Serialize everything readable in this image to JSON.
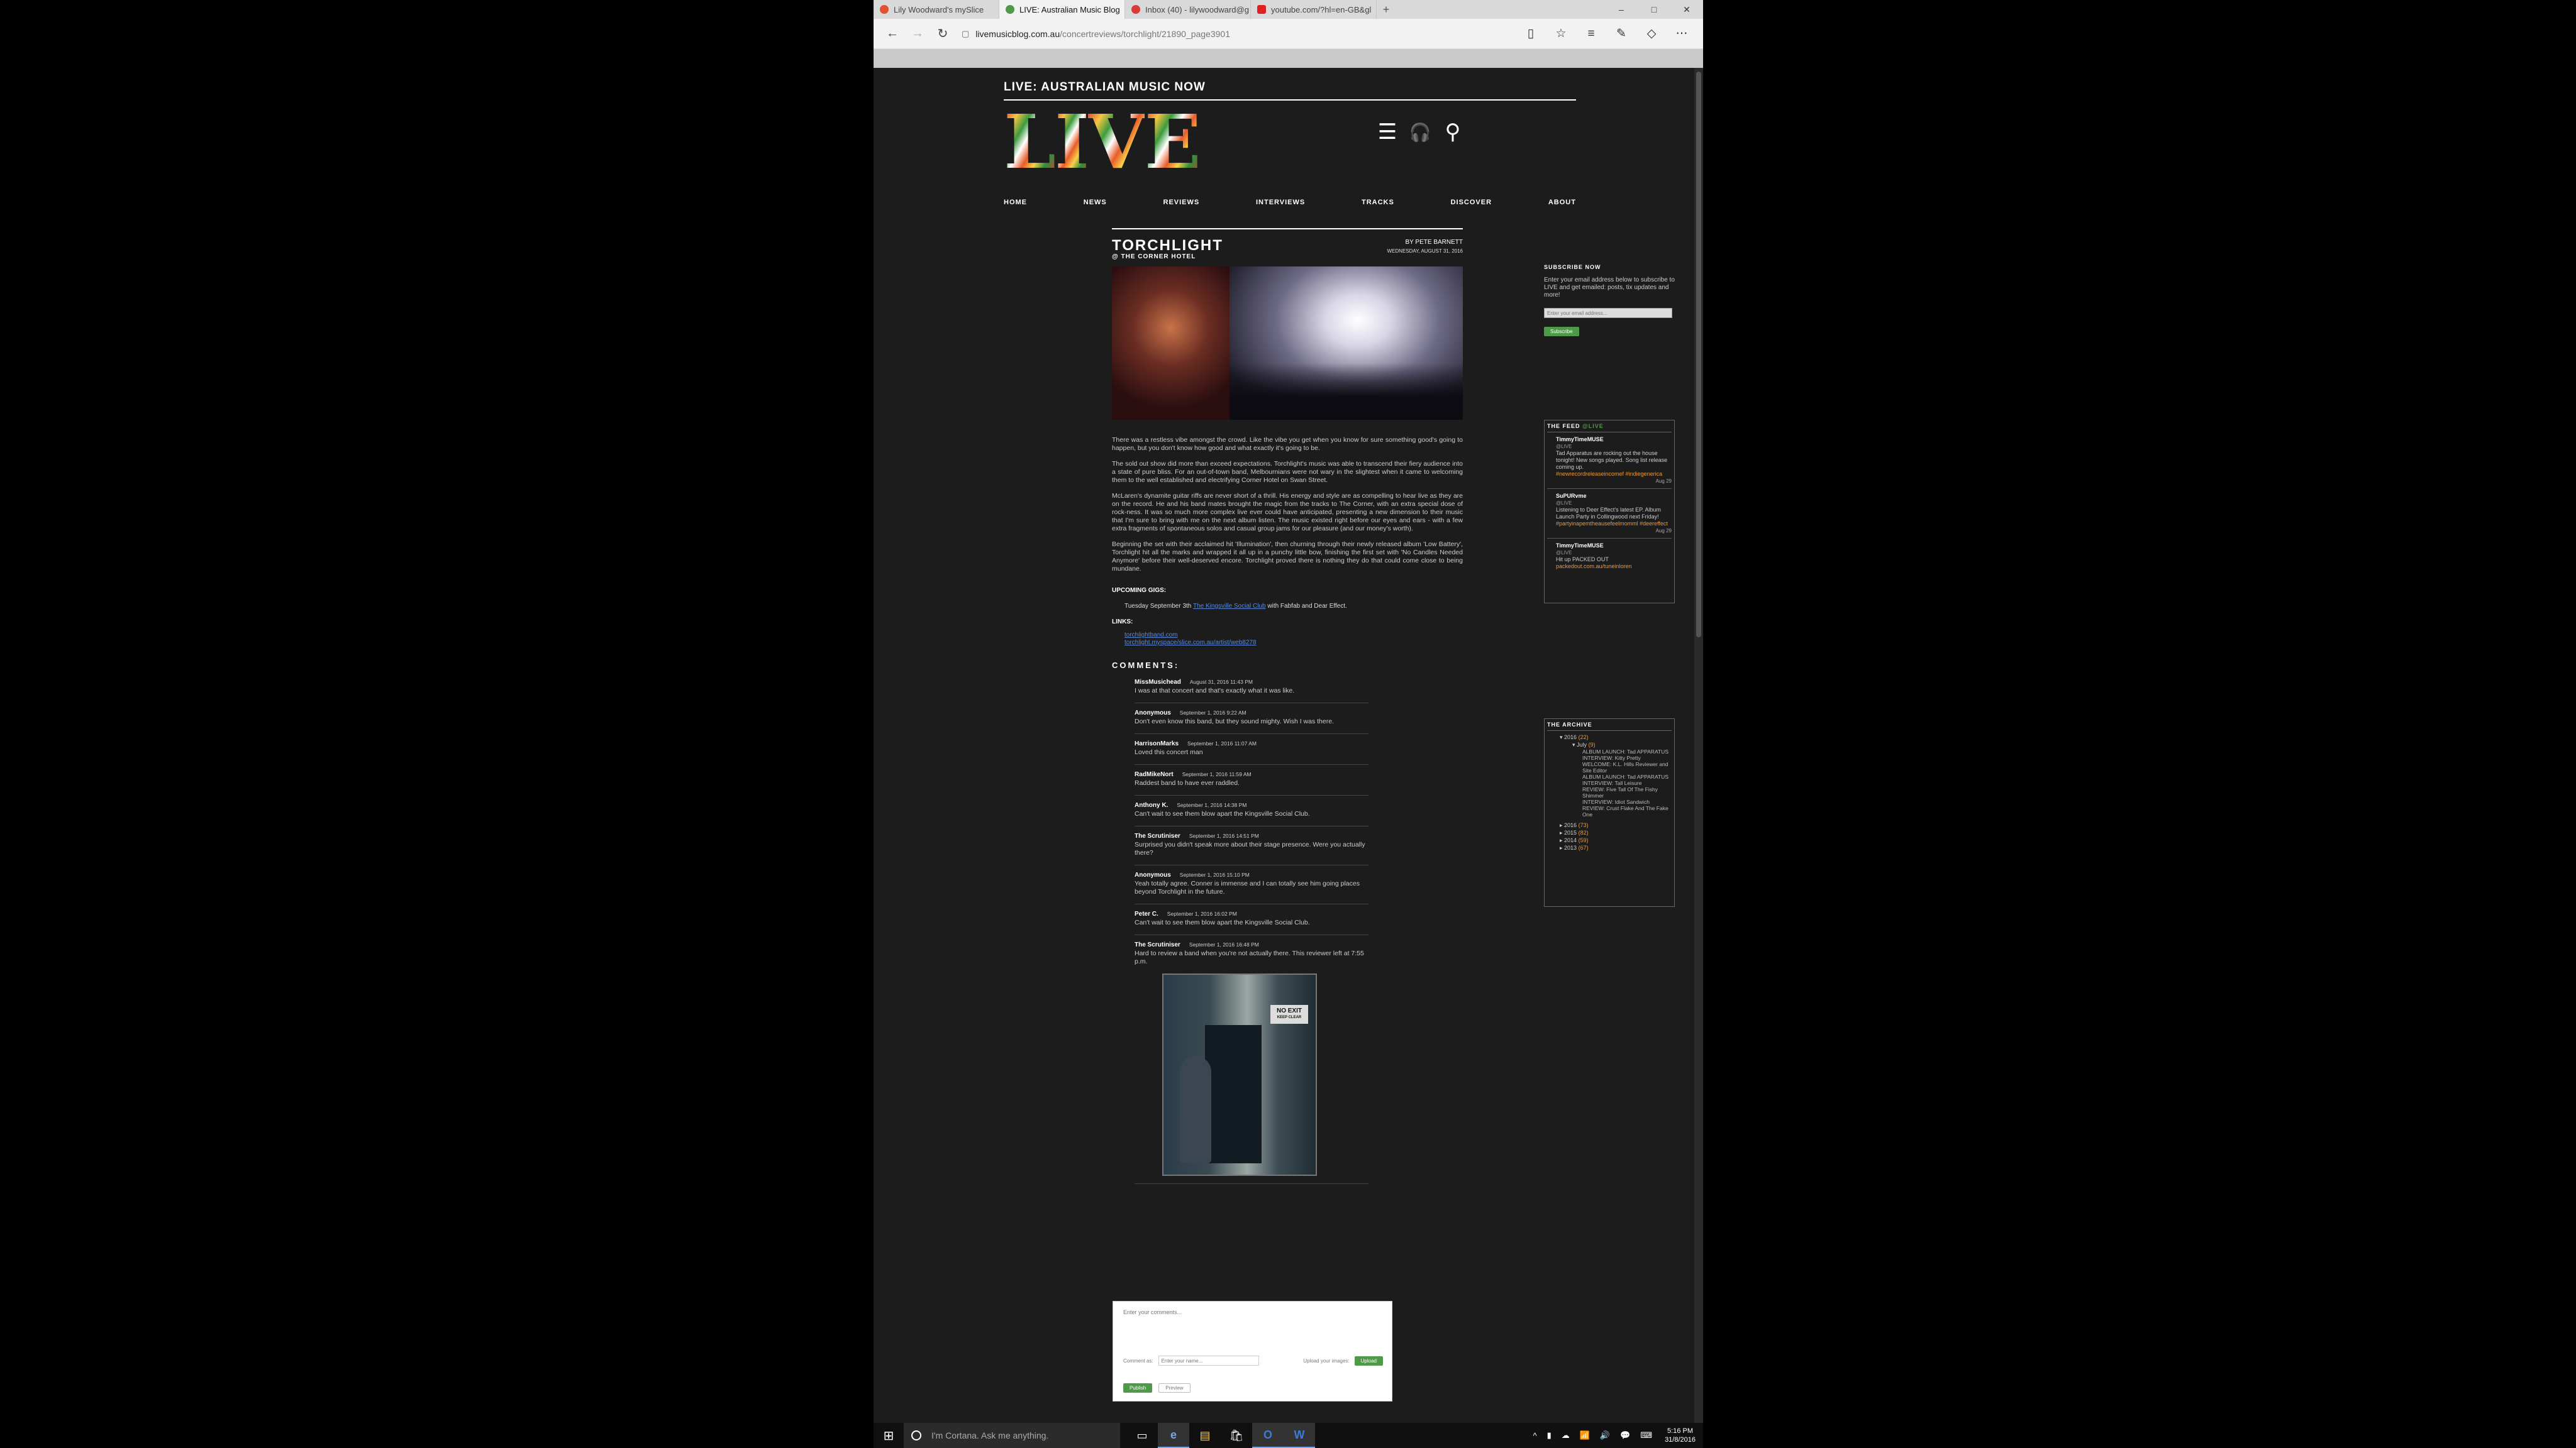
{
  "browser": {
    "tabs": [
      {
        "label": "Lily Woodward's mySlice",
        "color": "#e0522d",
        "active": false
      },
      {
        "label": "LIVE: Australian Music Blog",
        "color": "#4f9a49",
        "active": true
      },
      {
        "label": "Inbox (40) - lilywoodward@g",
        "color": "#d93b3b",
        "active": false
      },
      {
        "label": "youtube.com/?hl=en-GB&gl",
        "color": "#e02020",
        "active": false
      }
    ],
    "url_domain": "livemusicblog.com.au",
    "url_path": "/concertreviews/torchlight/21890_page3901",
    "back_icon": "←",
    "forward_icon": "→",
    "refresh_icon": "↻",
    "new_tab_icon": "+",
    "minimize_icon": "–",
    "maximize_icon": "□",
    "close_icon": "✕",
    "reading_icon": "▯",
    "star_icon": "☆",
    "hub_icon": "≡",
    "note_icon": "✎",
    "share_icon": "◇",
    "more_icon": "⋯"
  },
  "site": {
    "tagline": "LIVE: AUSTRALIAN MUSIC NOW",
    "logo_letters": [
      "L",
      "I",
      "V",
      "E"
    ],
    "menu_icon": "☰",
    "headphones_icon": "🎧",
    "search_icon": "⚲",
    "nav": [
      "HOME",
      "NEWS",
      "REVIEWS",
      "INTERVIEWS",
      "TRACKS",
      "DISCOVER",
      "ABOUT"
    ]
  },
  "article": {
    "title": "TORCHLIGHT",
    "subtitle": "@ THE CORNER HOTEL",
    "byline": "BY PETE BARNETT",
    "date": "WEDNESDAY, AUGUST 31, 2016",
    "paragraphs": [
      "There was a restless vibe amongst the crowd. Like the vibe you get when you know for sure something good's going to happen, but you don't know how good and what exactly it's going to be.",
      "The sold out show did more than exceed expectations. Torchlight's music was able to transcend their fiery audience into a state of pure bliss. For an out-of-town band, Melbournians were not wary in the slightest when it came to welcoming them to the well established and electrifying Corner Hotel on Swan Street.",
      "McLaren's dynamite guitar riffs are never short of a thrill. His energy and style are as compelling to hear live as they are on the record. He and his band mates brought the magic from the tracks to The Corner, with an extra special dose of rock-ness. It was so much more complex live ever could have anticipated, presenting a new dimension to their music that I'm sure to bring with me on the next album listen. The music existed right before our eyes and ears - with a few extra fragments of spontaneous solos and casual group jams for our pleasure (and our money's worth).",
      "Beginning the set with their acclaimed hit 'Illumination', then churning through their newly released album 'Low Battery', Torchlight hit all the marks and wrapped it all up in a punchy little bow, finishing the first set with 'No Candles Needed Anymore' before their well-deserved encore. Torchlight proved there is nothing they do that could come close to being mundane."
    ],
    "upcoming_label": "UPCOMING GIGS:",
    "gig_prefix": "Tuesday September 3th",
    "gig_link": "The Kingsville Social Club",
    "gig_suffix": "with Fabfab and Dear Effect.",
    "links_label": "LINKS:",
    "links": [
      "torchlightband.com",
      "torchlight.myspace/slice.com.au/artist/web8278"
    ]
  },
  "comments": {
    "heading": "COMMENTS:",
    "items": [
      {
        "author": "MissMusichead",
        "date": "August 31, 2016 11:43 PM",
        "text": "I was at that concert and that's exactly what it was like."
      },
      {
        "author": "Anonymous",
        "date": "September 1, 2016 9:22 AM",
        "text": "Don't even know this band, but they sound mighty. Wish I was there."
      },
      {
        "author": "HarrisonMarks",
        "date": "September 1, 2016 11:07 AM",
        "text": "Loved this concert man"
      },
      {
        "author": "RadMikeNort",
        "date": "September 1, 2016 11:59 AM",
        "text": "Raddest band to have ever raddled."
      },
      {
        "author": "Anthony K.",
        "date": "September 1, 2016 14:38 PM",
        "text": "Can't wait to see them blow apart the Kingsville Social Club."
      },
      {
        "author": "The Scrutiniser",
        "date": "September 1, 2016 14:51 PM",
        "text": "Surprised you didn't speak more about their stage presence. Were you actually there?"
      },
      {
        "author": "Anonymous",
        "date": "September 1, 2016 15:10 PM",
        "text": "Yeah totally agree. Conner is immense and I can totally see him going places beyond Torchlight in the future."
      },
      {
        "author": "Peter C.",
        "date": "September 1, 2016 16:02 PM",
        "text": "Can't wait to see them blow apart the Kingsville Social Club."
      },
      {
        "author": "The Scrutiniser",
        "date": "September 1, 2016 16:48 PM",
        "text": "Hard to review a band when you're not actually there. This reviewer left at 7:55 p.m."
      }
    ],
    "image_sign": "NO EXIT",
    "image_sign_sub": "KEEP CLEAR"
  },
  "comment_form": {
    "textarea_placeholder": "Enter your comments...",
    "comment_as": "Comment as:",
    "name_placeholder": "Enter your name...",
    "upload_label": "Upload your images:",
    "upload_button": "Upload",
    "publish_button": "Publish",
    "preview_button": "Preview"
  },
  "sidebar": {
    "subscribe": {
      "heading": "SUBSCRIBE NOW",
      "text": "Enter your email address below to subscribe to LIVE and get emailed: posts, tix updates and more!",
      "input_placeholder": "Enter your email address...",
      "button": "Subscribe"
    },
    "feed": {
      "heading": "THE FEED",
      "live": "@LIVE",
      "items": [
        {
          "user": "TimmyTimeMUSE",
          "handle": "@LIVE",
          "text": "Tad Apparatus are rocking out the house tonight! New songs played. Song list release coming up.",
          "tags": "#newrecordreleaseincomef #indiegenerica",
          "date": "Aug 29"
        },
        {
          "user": "SuPURvme",
          "handle": "@LIVE",
          "text": "Listening to Deer Effect's latest EP. Album Launch Party in Collingwood next Friday!",
          "tags": "#partyinapemtheausefeelmomml #deereffect",
          "date": "Aug 29"
        },
        {
          "user": "TimmyTimeMUSE",
          "handle": "@LIVE",
          "text": "Hit up PACKED OUT",
          "tags": "packedout.com.au/tuneinloren",
          "date": ""
        }
      ]
    },
    "archive": {
      "heading": "THE ARCHIVE",
      "year_current": "2016",
      "year_current_count": "(22)",
      "month": "July",
      "month_count": "(9)",
      "posts": [
        "ALBUM LAUNCH: Tad APPARATUS",
        "INTERVIEW: Kitty Pretty",
        "WELCOME: K.L. Hills Reviewer and Site Editor",
        "ALBUM LAUNCH: Tad APPARATUS",
        "INTERVIEW: Tall Leisure",
        "REVIEW: Five Tall Of The Fishy Shimmer",
        "INTERVIEW: Idiot Sandwich",
        "REVIEW: Crust Flake And The Fake One"
      ],
      "years": [
        {
          "year": "2016",
          "count": "(73)"
        },
        {
          "year": "2015",
          "count": "(82)"
        },
        {
          "year": "2014",
          "count": "(59)"
        },
        {
          "year": "2013",
          "count": "(67)"
        }
      ]
    }
  },
  "taskbar": {
    "start_icon": "⊞",
    "cortana": "I'm Cortana. Ask me anything.",
    "apps": [
      "▭",
      "e",
      "▤",
      "🛍",
      "O",
      "W"
    ],
    "tray": [
      "^",
      "▮",
      "☁",
      "📶",
      "🔊",
      "💬",
      "⌨"
    ],
    "time": "5:16 PM",
    "date": "31/8/2016"
  }
}
